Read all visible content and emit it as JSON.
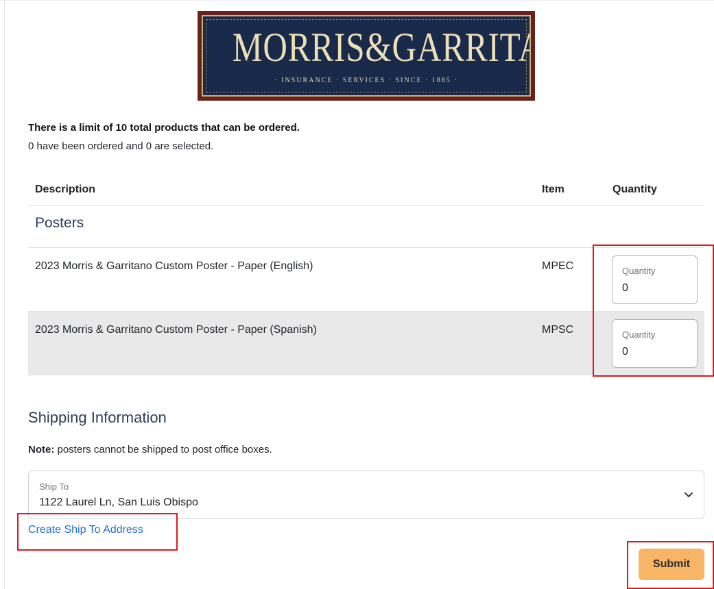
{
  "logo": {
    "brand": "MORRIS&GARRITANO",
    "tagline": "· INSURANCE · SERVICES · SINCE · 1885 ·",
    "colors": {
      "frame": "#6b211b",
      "panel": "#18294a",
      "text": "#ecdfb7"
    }
  },
  "order_limit": {
    "title": "There is a limit of 10 total products that can be ordered.",
    "status": "0 have been ordered and 0 are selected."
  },
  "table": {
    "headers": {
      "description": "Description",
      "item": "Item",
      "quantity": "Quantity"
    },
    "category": "Posters",
    "rows": [
      {
        "description": "2023 Morris & Garritano Custom Poster - Paper (English)",
        "item": "MPEC",
        "quantity_label": "Quantity",
        "quantity": "0"
      },
      {
        "description": "2023 Morris & Garritano Custom Poster - Paper (Spanish)",
        "item": "MPSC",
        "quantity_label": "Quantity",
        "quantity": "0"
      }
    ]
  },
  "shipping": {
    "heading": "Shipping Information",
    "note_label": "Note:",
    "note_text": " posters cannot be shipped to post office boxes.",
    "ship_to_label": "Ship To",
    "ship_to_value": "1122 Laurel Ln, San Luis Obispo",
    "create_link": "Create Ship To Address"
  },
  "actions": {
    "submit_label": "Submit"
  },
  "colors": {
    "accent": "#f8b566",
    "link": "#1f6fd1",
    "highlight": "#e3161e",
    "alt_row": "#e9e9ea"
  },
  "icons": {
    "select_toggle": "chevron-down-icon"
  }
}
